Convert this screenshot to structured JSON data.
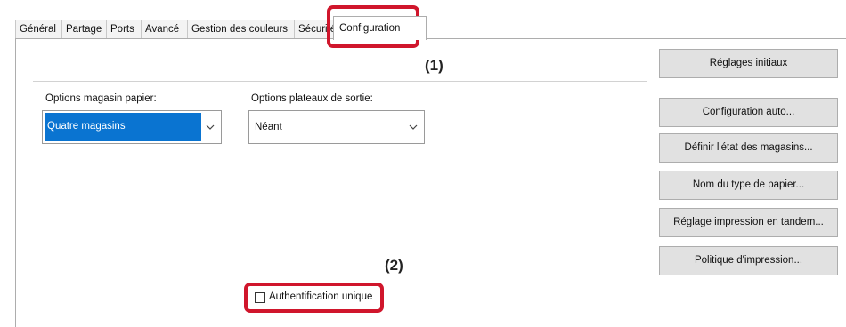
{
  "tabs": [
    {
      "label": "Général"
    },
    {
      "label": "Partage"
    },
    {
      "label": "Ports"
    },
    {
      "label": "Avancé"
    },
    {
      "label": "Gestion des couleurs"
    },
    {
      "label": "Sécurité"
    },
    {
      "label": "Configuration"
    }
  ],
  "callouts": {
    "one": "(1)",
    "two": "(2)"
  },
  "buttons": {
    "initial_settings": "Réglages initiaux",
    "auto_config": "Configuration auto...",
    "tray_status": "Définir l'état des magasins...",
    "paper_type_name": "Nom du type de papier...",
    "tandem_print": "Réglage impression en tandem...",
    "print_policy": "Politique d'impression..."
  },
  "paper_tray": {
    "label": "Options magasin papier:",
    "value": "Quatre magasins"
  },
  "output_tray": {
    "label": "Options plateaux de sortie:",
    "value": "Néant"
  },
  "single_sign_on": {
    "label": "Authentification unique",
    "checked": false
  },
  "colors": {
    "highlight": "#d0162c",
    "selection": "#0a74d1"
  },
  "icons": {
    "dropdown": "chevron-down-icon"
  }
}
